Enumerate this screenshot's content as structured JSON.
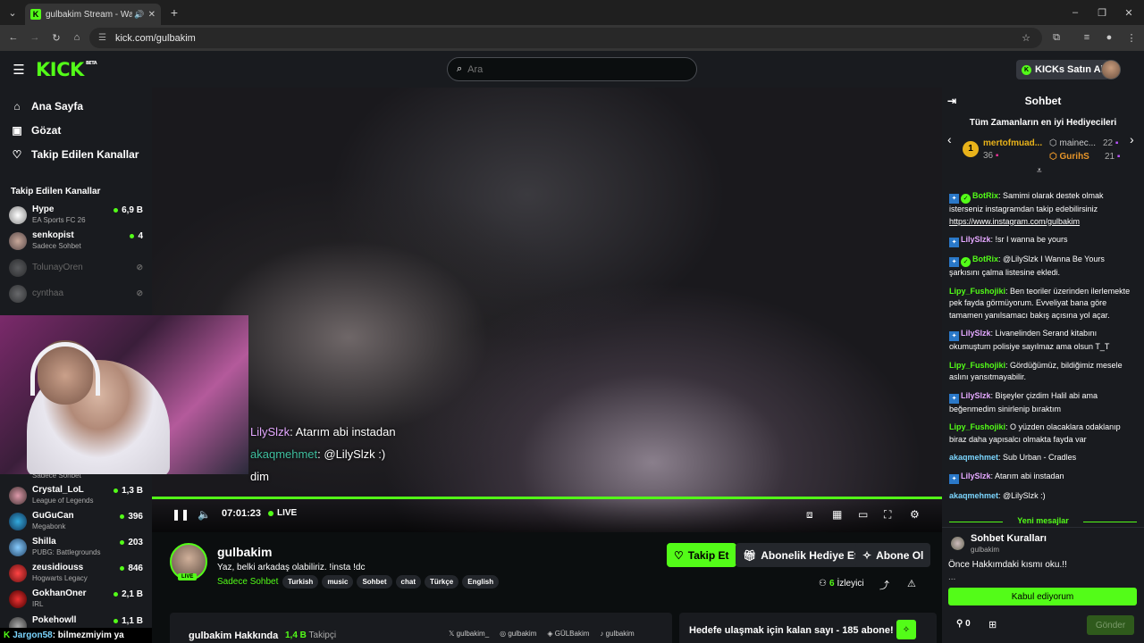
{
  "browser": {
    "tab_title": "gulbakim Stream - Watch L",
    "url": "kick.com/gulbakim"
  },
  "header": {
    "logo": "KICK",
    "logo_badge": "BETA",
    "search_placeholder": "Ara",
    "buy_kicks": "KICKs Satın Al"
  },
  "sidebar": {
    "nav": [
      {
        "label": "Ana Sayfa",
        "icon": "home-icon"
      },
      {
        "label": "Gözat",
        "icon": "browse-icon"
      },
      {
        "label": "Takip Edilen Kanallar",
        "icon": "heart-icon"
      }
    ],
    "heading": "Takip Edilen Kanallar",
    "channels_top": [
      {
        "name": "Hype",
        "game": "EA Sports FC 26",
        "viewers": "6,9 B",
        "live": true
      },
      {
        "name": "senkopist",
        "game": "Sadece Sohbet",
        "viewers": "4",
        "live": true
      },
      {
        "name": "TolunayOren",
        "game": "",
        "viewers": "",
        "live": false
      },
      {
        "name": "cynthaa",
        "game": "",
        "viewers": "",
        "live": false
      }
    ],
    "channels_bottom": [
      {
        "name": "Crystal_LoL",
        "game": "League of Legends",
        "viewers": "1,3 B"
      },
      {
        "name": "GuGuCan",
        "game": "Megabonk",
        "viewers": "396"
      },
      {
        "name": "Shilla",
        "game": "PUBG: Battlegrounds",
        "viewers": "203"
      },
      {
        "name": "zeusidiouss",
        "game": "Hogwarts Legacy",
        "viewers": "846"
      },
      {
        "name": "GokhanOner",
        "game": "IRL",
        "viewers": "2,1 B"
      },
      {
        "name": "Pokehowll",
        "game": "",
        "viewers": "1,1 B"
      }
    ],
    "partial_game": "Sadece Sohbet"
  },
  "ticker": {
    "user": "Jargon58",
    "text": ": bilmezmiyim ya"
  },
  "video": {
    "overlay_chat": [
      {
        "user": "LilySlzk",
        "text": ": Atarım abi instadan"
      },
      {
        "user": "akaqmehmet",
        "text": ": @LilySlzk :)"
      },
      {
        "user": "",
        "text": "dim"
      }
    ],
    "time": "07:01:23",
    "live_label": "LIVE",
    "progress": 1.0
  },
  "stream": {
    "channel": "gulbakim",
    "title": "Yaz, belki arkadaş olabiliriz. !insta !dc",
    "category": "Sadece Sohbet",
    "tags": [
      "Turkish",
      "music",
      "Sohbet",
      "chat",
      "Türkçe",
      "English"
    ],
    "live_badge": "LIVE",
    "follow": "Takip Et",
    "gift_sub": "Abonelik Hediye Et",
    "subscribe": "Abone Ol",
    "viewers_count": "6",
    "viewers_label": "İzleyici",
    "about_title": "gulbakim Hakkında",
    "followers_count": "1,4 B",
    "followers_label": "Takipçi",
    "socials": [
      "gulbakim_",
      "gulbakim",
      "GÜLBakim",
      "gulbakim"
    ],
    "goal_text": "Hedefe ulaşmak için kalan sayı - 185 abone!"
  },
  "chat": {
    "title": "Sohbet",
    "gifters_heading": "Tüm Zamanların en iyi Hediyecileri",
    "gifters": [
      {
        "rank": "1",
        "name": "mertofmuad...",
        "count": "36"
      },
      {
        "rank": "",
        "name": "mainec...",
        "count": "22"
      },
      {
        "rank": "",
        "name": "GurihS",
        "count": "21"
      }
    ],
    "messages": [
      {
        "user": "BotRix",
        "color": "green",
        "verified": true,
        "text": ": Samimi olarak destek olmak isterseniz instagramdan takip edebilirsiniz ",
        "link": "https://www.instagram.com/gulbakim"
      },
      {
        "user": "LilySlzk",
        "color": "purple",
        "verified": false,
        "text": ": !sr I wanna be yours",
        "link": ""
      },
      {
        "user": "BotRix",
        "color": "green",
        "verified": true,
        "text": ": @LilySlzk I Wanna Be Yours şarkısını çalma listesine ekledi.",
        "link": ""
      },
      {
        "user": "Lipy_Fushojiki",
        "color": "green",
        "verified": false,
        "text": ": Ben teoriler üzerinden ilerlemekte pek fayda görmüyorum. Evveliyat bana göre tamamen yanılsamacı bakış açısına yol açar.",
        "link": ""
      },
      {
        "user": "LilySlzk",
        "color": "purple",
        "verified": false,
        "text": ": Livanelinden Serand kitabını okumuştum polisiye sayılmaz ama olsun T_T",
        "link": ""
      },
      {
        "user": "Lipy_Fushojiki",
        "color": "green",
        "verified": false,
        "text": ": Gördüğümüz, bildiğimiz mesele aslını yansıtmayabilir.",
        "link": ""
      },
      {
        "user": "LilySlzk",
        "color": "purple",
        "verified": false,
        "text": ": Bişeyler çizdim Halil abi ama beğenmedim sinirlenip bıraktım",
        "link": ""
      },
      {
        "user": "Lipy_Fushojiki",
        "color": "green",
        "verified": false,
        "text": ": O yüzden olacaklara odaklanıp biraz daha yapısalcı olmakta fayda var",
        "link": ""
      },
      {
        "user": "akaqmehmet",
        "color": "cyan",
        "verified": false,
        "text": ": Sub Urban - Cradles",
        "link": ""
      },
      {
        "user": "LilySlzk",
        "color": "purple",
        "verified": false,
        "text": ": Atarım abi instadan",
        "link": ""
      },
      {
        "user": "akaqmehmet",
        "color": "cyan",
        "verified": false,
        "text": ": @LilySlzk :)",
        "link": ""
      }
    ],
    "new_messages": "Yeni mesajlar",
    "rules_title": "Sohbet Kuralları",
    "rules_owner": "gulbakim",
    "rules_body": "Önce Hakkımdaki kısmı oku.!!",
    "rules_ellipsis": "...",
    "accept": "Kabul ediyorum",
    "kicks_count": "0",
    "send": "Gönder"
  },
  "colors": {
    "accent": "#53fc18",
    "bg": "#0b0e0f",
    "panel": "#191b1f"
  }
}
